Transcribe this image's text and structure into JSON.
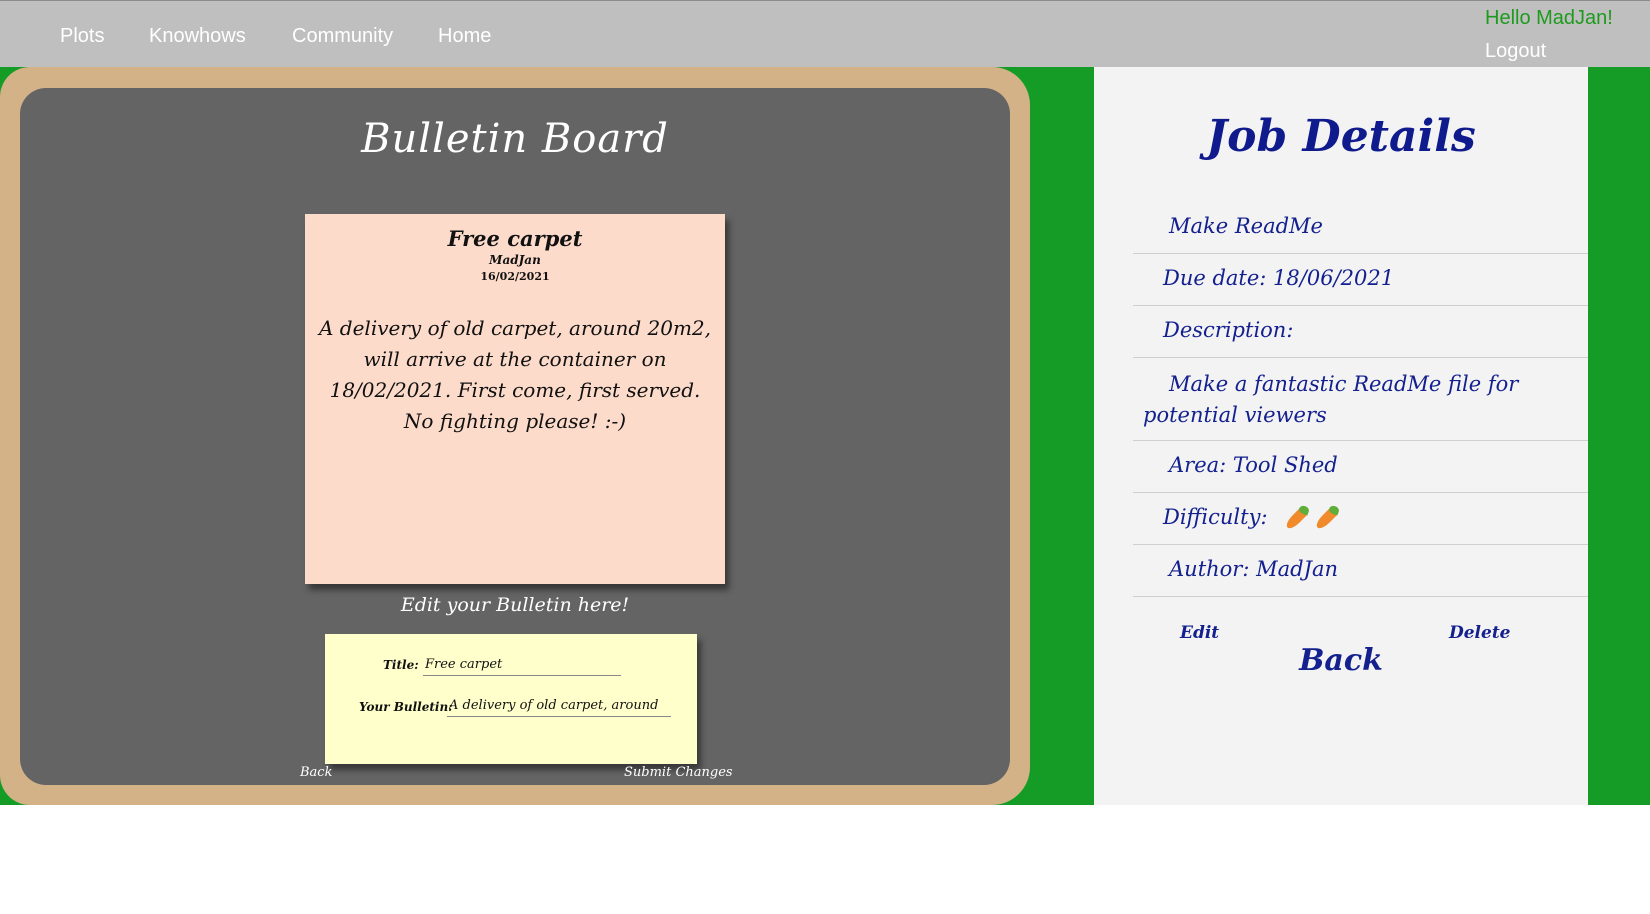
{
  "nav": {
    "links": [
      "Plots",
      "Knowhows",
      "Community",
      "Home"
    ],
    "greeting": "Hello MadJan!",
    "logout": "Logout"
  },
  "board": {
    "title": "Bulletin Board",
    "note": {
      "title": "Free carpet",
      "author": "MadJan",
      "date": "16/02/2021",
      "body": "A delivery of old carpet, around 20m2, will arrive at the container on 18/02/2021. First come, first served. No fighting please! :-)"
    },
    "edit_heading": "Edit your Bulletin here!",
    "form": {
      "title_label": "Title:",
      "title_value": "Free carpet",
      "bulletin_label": "Your Bulletin:",
      "bulletin_value": "A delivery of old carpet, around"
    },
    "back": "Back",
    "submit": "Submit Changes"
  },
  "job": {
    "heading": "Job Details",
    "name": "Make ReadMe",
    "due": "Due date: 18/06/2021",
    "description_label": "Description:",
    "description": "Make a fantastic ReadMe file for potential viewers",
    "area": "Area: Tool Shed",
    "difficulty_label": "Difficulty:",
    "difficulty_level": 2,
    "difficulty_icon": "carrot-icon",
    "author": "Author: MadJan",
    "edit": "Edit",
    "delete": "Delete",
    "back": "Back"
  },
  "colors": {
    "nav_bg": "#bfbfbf",
    "green": "#159c26",
    "board": "#646464",
    "frame": "#d3b288",
    "note": "#fddbcb",
    "form_note": "#ffffcc",
    "panel_text": "#13208e"
  }
}
